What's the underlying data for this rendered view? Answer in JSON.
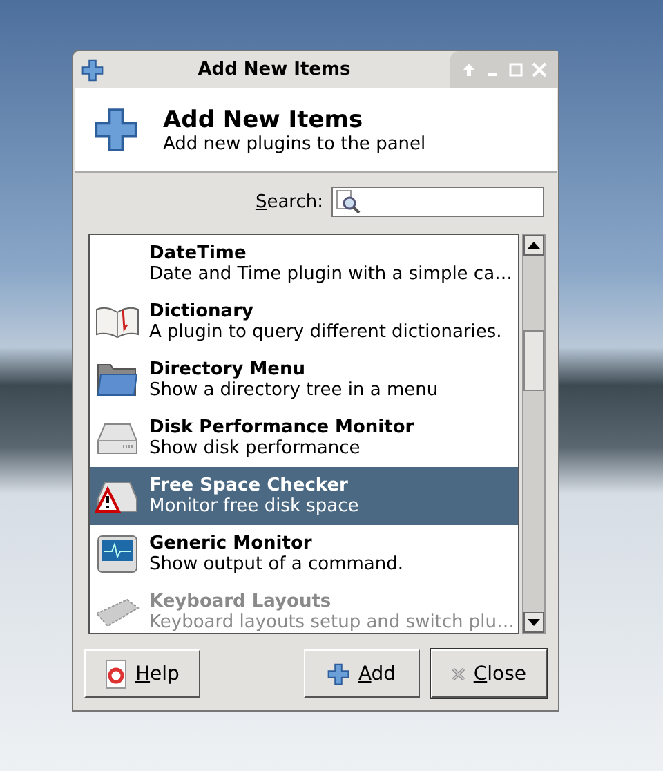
{
  "window": {
    "title": "Add New Items"
  },
  "header": {
    "title": "Add New Items",
    "subtitle": "Add new plugins to the panel"
  },
  "search": {
    "label": "Search:",
    "mnemonic": true
  },
  "items": [
    {
      "name": "DateTime",
      "description": "Date and Time plugin with a simple ca…",
      "kind": "blank",
      "selected": false,
      "disabled": false
    },
    {
      "name": "Dictionary",
      "description": "A plugin to query different dictionaries.",
      "kind": "book",
      "selected": false,
      "disabled": false
    },
    {
      "name": "Directory Menu",
      "description": "Show a directory tree in a menu",
      "kind": "folder",
      "selected": false,
      "disabled": false
    },
    {
      "name": "Disk Performance Monitor",
      "description": "Show disk performance",
      "kind": "disk",
      "selected": false,
      "disabled": false
    },
    {
      "name": "Free Space Checker",
      "description": "Monitor free disk space",
      "kind": "warning",
      "selected": true,
      "disabled": false
    },
    {
      "name": "Generic Monitor",
      "description": "Show output of a command.",
      "kind": "monitor",
      "selected": false,
      "disabled": false
    },
    {
      "name": "Keyboard Layouts",
      "description": "Keyboard layouts setup and switch plu…",
      "kind": "keyboard",
      "selected": false,
      "disabled": true
    }
  ],
  "buttons": [
    {
      "label": "Help",
      "kind": "help",
      "mnemonic": true
    },
    {
      "label": "Add",
      "kind": "add",
      "mnemonic": true
    },
    {
      "label": "Close",
      "kind": "close",
      "mnemonic": true
    }
  ]
}
